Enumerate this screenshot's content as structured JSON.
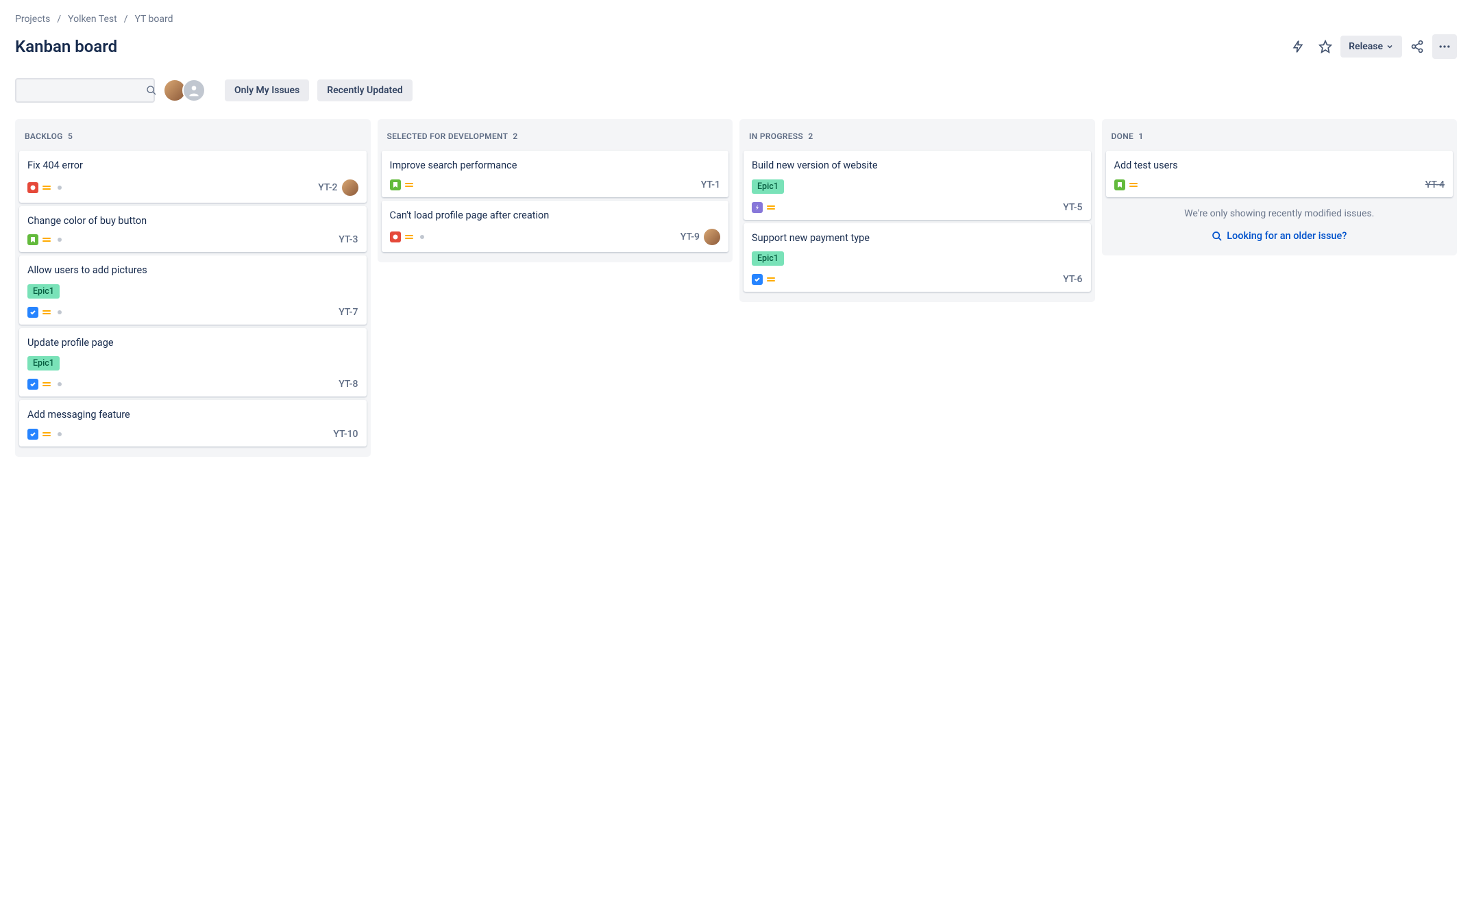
{
  "breadcrumb": {
    "items": [
      "Projects",
      "Yolken Test",
      "YT board"
    ]
  },
  "page_title": "Kanban board",
  "header_actions": {
    "release_label": "Release"
  },
  "filters": {
    "only_my_issues": "Only My Issues",
    "recently_updated": "Recently Updated"
  },
  "epic_labels": {
    "epic1": "Epic1"
  },
  "columns": [
    {
      "name": "Backlog",
      "count": 5,
      "cards": [
        {
          "title": "Fix 404 error",
          "type": "bug",
          "flagged": true,
          "key": "YT-2",
          "assignee": "photo"
        },
        {
          "title": "Change color of buy button",
          "type": "story",
          "flagged": true,
          "key": "YT-3"
        },
        {
          "title": "Allow users to add pictures",
          "epic": "epic1",
          "type": "task",
          "flagged": true,
          "key": "YT-7"
        },
        {
          "title": "Update profile page",
          "epic": "epic1",
          "type": "task",
          "flagged": true,
          "key": "YT-8"
        },
        {
          "title": "Add messaging feature",
          "type": "task",
          "flagged": true,
          "key": "YT-10"
        }
      ]
    },
    {
      "name": "Selected for Development",
      "count": 2,
      "cards": [
        {
          "title": "Improve search performance",
          "type": "story",
          "key": "YT-1"
        },
        {
          "title": "Can't load profile page after creation",
          "type": "bug",
          "flagged": true,
          "key": "YT-9",
          "assignee": "photo"
        }
      ]
    },
    {
      "name": "In Progress",
      "count": 2,
      "cards": [
        {
          "title": "Build new version of website",
          "epic": "epic1",
          "type": "epic",
          "key": "YT-5"
        },
        {
          "title": "Support new payment type",
          "epic": "epic1",
          "type": "task",
          "key": "YT-6"
        }
      ]
    },
    {
      "name": "Done",
      "count": 1,
      "cards": [
        {
          "title": "Add test users",
          "type": "story",
          "key": "YT-4",
          "done": true
        }
      ],
      "done_note": "We're only showing recently modified issues.",
      "older_link": "Looking for an older issue?"
    }
  ]
}
